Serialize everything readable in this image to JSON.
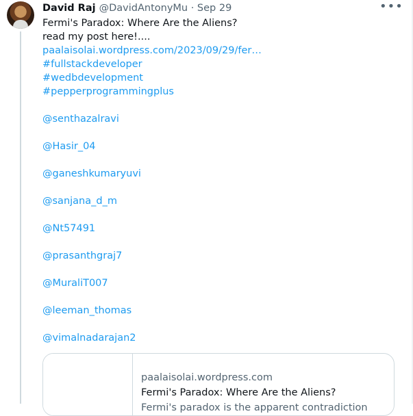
{
  "tweet": {
    "author_name": "David Raj",
    "meta": "@DavidAntonyMu · Sep 29",
    "more_icon": "more-horizontal-icon",
    "body": {
      "line1": "Fermi's Paradox: Where Are the Aliens?",
      "line2": "read my post here!....",
      "link_url": "paalaisolai.wordpress.com/2023/09/29/fer…",
      "hashtags": [
        "#fullstackdeveloper",
        "#wedbdevelopment",
        "#pepperprogrammingplus"
      ],
      "mentions": [
        "@senthazalravi",
        "@Hasir_04",
        "@ganeshkumaryuvi",
        "@sanjana_d_m",
        "@Nt57491",
        "@prasanthgraj7",
        "@MuraliT007",
        "@leeman_thomas",
        "@vimalnadarajan2"
      ]
    },
    "card": {
      "domain": "paalaisolai.wordpress.com",
      "title": "Fermi's Paradox: Where Are the Aliens?",
      "description": "Fermi's paradox is the apparent contradiction"
    }
  },
  "colors": {
    "link": "#1d9bf0",
    "secondary_text": "#536471",
    "border": "#cfd9de"
  }
}
